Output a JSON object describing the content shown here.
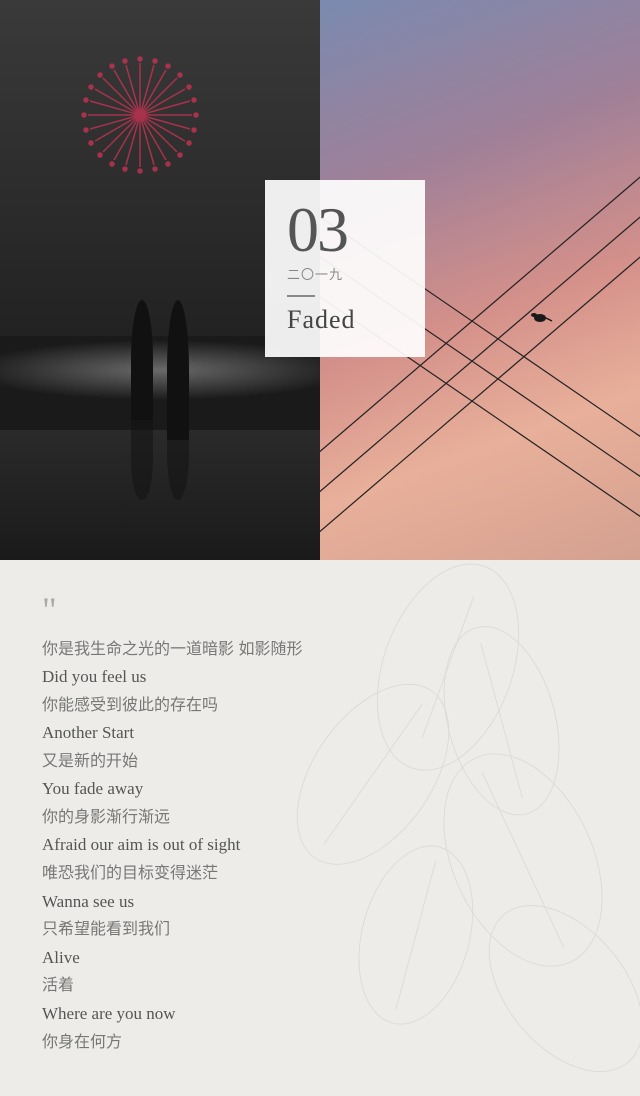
{
  "card": {
    "number": "03",
    "year": "二〇一九",
    "title": "Faded"
  },
  "lyrics": {
    "quote": "““",
    "lines": [
      {
        "text": "你是我生命之光的一道暗影 如影随形",
        "lang": "zh"
      },
      {
        "text": "Did you feel us",
        "lang": "en"
      },
      {
        "text": "你能感受到彼此的存在吗",
        "lang": "zh"
      },
      {
        "text": "Another Start",
        "lang": "en"
      },
      {
        "text": "又是新的开始",
        "lang": "zh"
      },
      {
        "text": "You fade away",
        "lang": "en"
      },
      {
        "text": "你的身影渐行渐远",
        "lang": "zh"
      },
      {
        "text": "Afraid our aim is out of sight",
        "lang": "en"
      },
      {
        "text": "唯恐我们的目标变得迷茫",
        "lang": "zh"
      },
      {
        "text": "Wanna see us",
        "lang": "en"
      },
      {
        "text": "只希望能看到我们",
        "lang": "zh"
      },
      {
        "text": "Alive",
        "lang": "en"
      },
      {
        "text": "活着",
        "lang": "zh"
      },
      {
        "text": "Where are you now",
        "lang": "en"
      },
      {
        "text": "你身在何方",
        "lang": "zh"
      }
    ]
  }
}
